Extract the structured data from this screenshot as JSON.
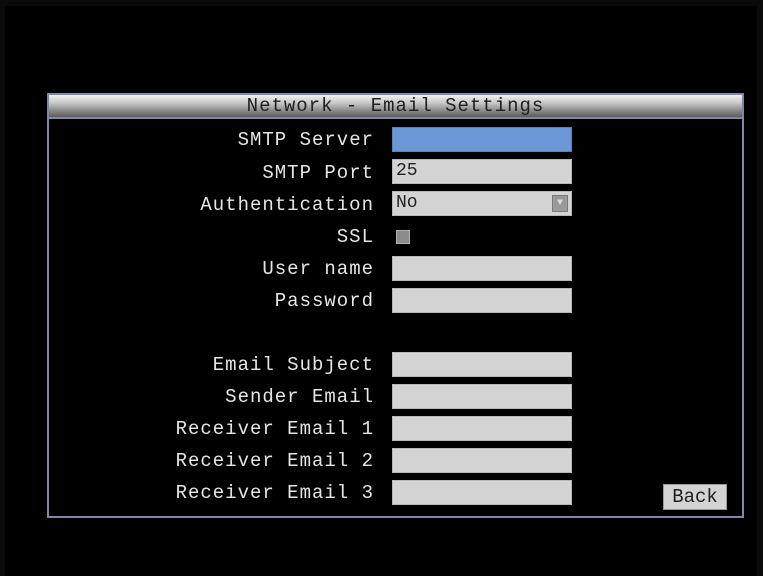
{
  "window": {
    "title": "Network - Email Settings"
  },
  "fields": [
    {
      "label": "SMTP Server",
      "value": "",
      "type": "text",
      "active": true
    },
    {
      "label": "SMTP Port",
      "value": "25",
      "type": "text"
    },
    {
      "label": "Authentication",
      "value": "No",
      "type": "dropdown",
      "icon": "chevron-down-icon"
    },
    {
      "label": "SSL",
      "type": "checkbox",
      "checked": false
    },
    {
      "label": "User name",
      "value": "",
      "type": "text"
    },
    {
      "label": "Password",
      "value": "",
      "type": "text"
    },
    {
      "label": "Email Subject",
      "value": "",
      "type": "text"
    },
    {
      "label": "Sender Email",
      "value": "",
      "type": "text"
    },
    {
      "label": "Receiver Email 1",
      "value": "",
      "type": "text"
    },
    {
      "label": "Receiver Email 2",
      "value": "",
      "type": "text"
    },
    {
      "label": "Receiver Email 3",
      "value": "",
      "type": "text"
    }
  ],
  "buttons": {
    "back_label": "Back"
  },
  "colors": {
    "background": "#000000",
    "panel_border": "#7f8aa2",
    "field_bg": "#d4d4d4",
    "active_field_bg": "#6c97d6",
    "label_text": "#e6e6e6"
  }
}
